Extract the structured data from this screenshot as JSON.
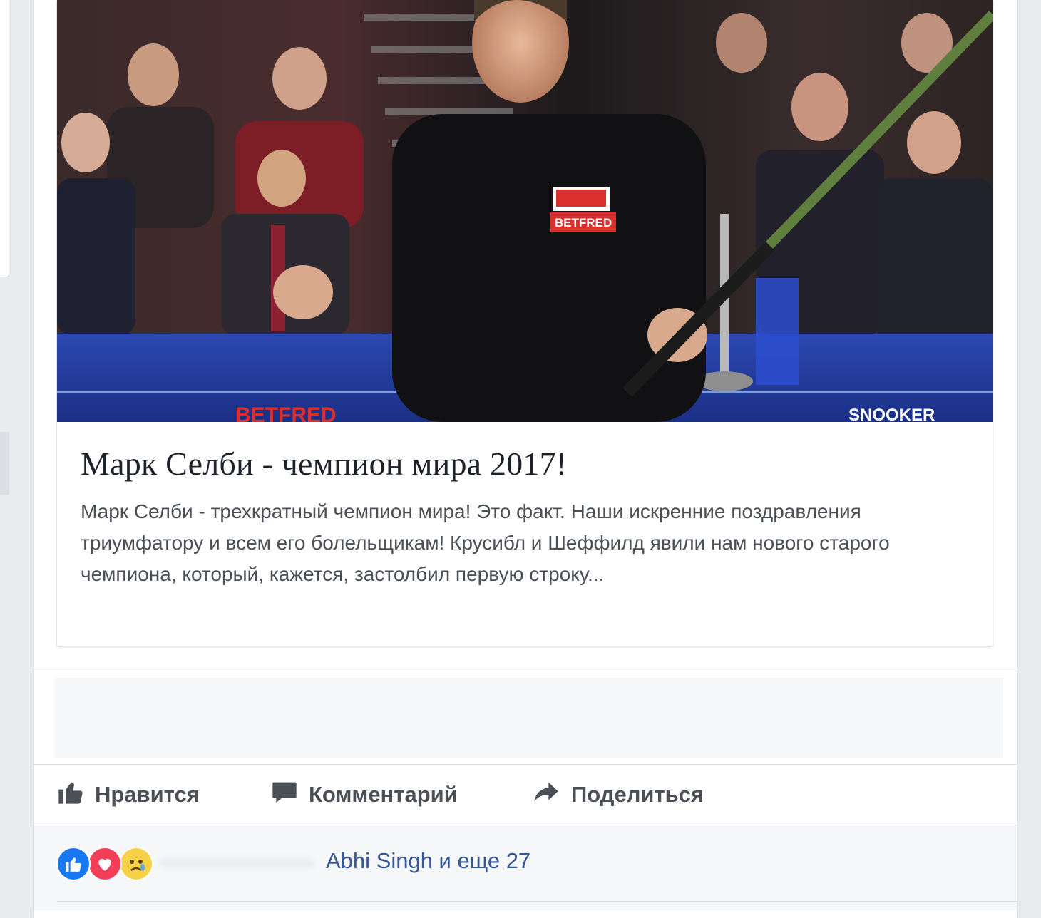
{
  "preview": {
    "title": "Марк Селби - чемпион мира 2017!",
    "description": "Марк Селби - трехкратный чемпион мира! Это факт. Наши искренние поздравления триумфатору и всем его болельщикам! Крусибл и Шеффилд явили нам нового старого чемпиона, который, кажется, застолбил первую строку...",
    "photo_texts": {
      "sponsor_badge": "BETFRED",
      "banner_left": "BETFRED",
      "banner_right": "SNOOKER"
    }
  },
  "actions": [
    {
      "label": "Нравится",
      "icon": "thumbs-up-icon"
    },
    {
      "label": "Комментарий",
      "icon": "comment-icon"
    },
    {
      "label": "Поделиться",
      "icon": "share-icon"
    }
  ],
  "reactions": {
    "icons": [
      "like-reaction-icon",
      "love-reaction-icon",
      "sad-reaction-icon"
    ],
    "summary": "Abhi Singh и еще 27"
  },
  "colors": {
    "link": "#365899",
    "like": "#1877f2",
    "love": "#f33e58",
    "sad": "#f7d146"
  }
}
